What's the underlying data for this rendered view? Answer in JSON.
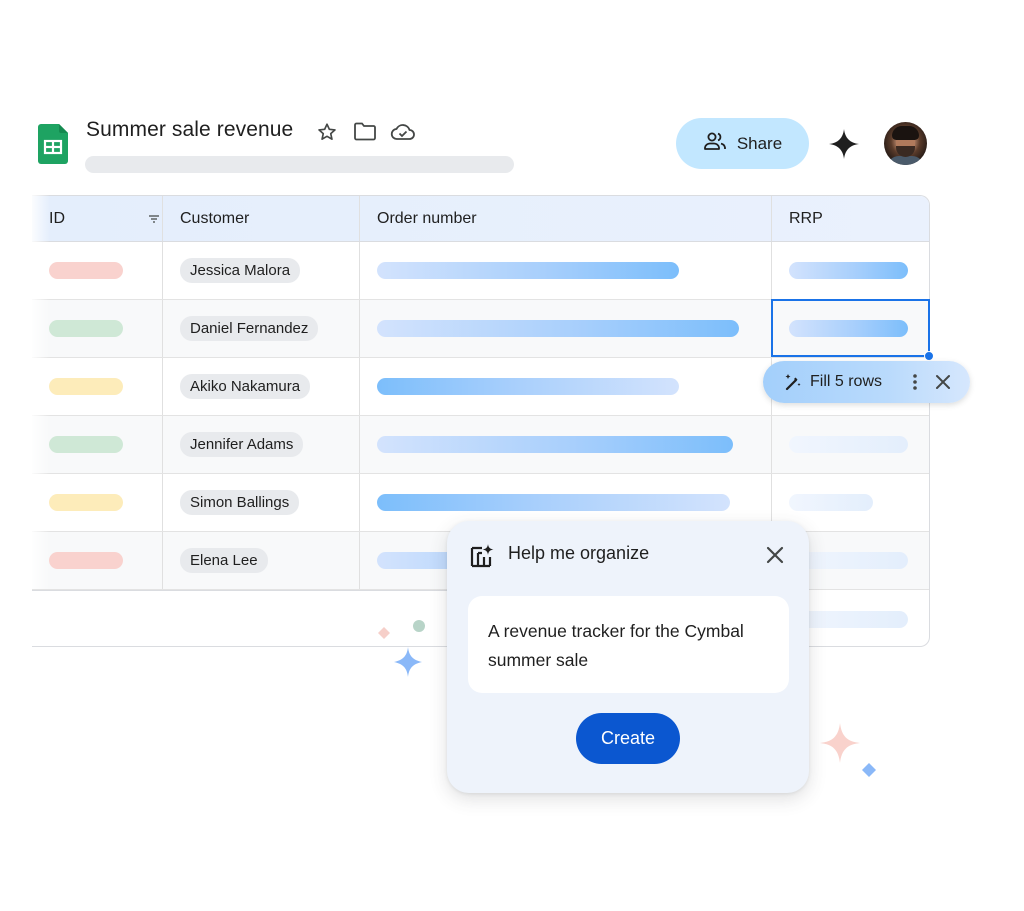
{
  "header": {
    "app_icon": "google-sheets-icon",
    "doc_title": "Summer sale revenue",
    "title_icons": [
      "star-icon",
      "folder-icon",
      "cloud-saved-icon"
    ],
    "share_label": "Share",
    "share_icon": "people-icon",
    "gemini_icon": "gemini-sparkle-icon",
    "avatar": "user-avatar"
  },
  "table": {
    "columns": [
      {
        "label": "ID",
        "icon": "filter-icon"
      },
      {
        "label": "Customer"
      },
      {
        "label": "Order number"
      },
      {
        "label": "RRP"
      }
    ],
    "rows": [
      {
        "id_color": "#f9d2ce",
        "customer": "Jessica Malora"
      },
      {
        "id_color": "#cfe8d6",
        "customer": "Daniel Fernandez"
      },
      {
        "id_color": "#fdecba",
        "customer": "Akiko Nakamura"
      },
      {
        "id_color": "#cfe8d6",
        "customer": "Jennifer Adams"
      },
      {
        "id_color": "#fdecba",
        "customer": "Simon Ballings"
      },
      {
        "id_color": "#f9d2ce",
        "customer": "Elena Lee"
      }
    ],
    "selected_cell": {
      "column": "RRP",
      "row": 2
    }
  },
  "fill_suggestion": {
    "icon": "magic-wand-icon",
    "label": "Fill 5 rows",
    "more_icon": "more-vert-icon",
    "close_icon": "close-icon"
  },
  "help_dialog": {
    "icon": "table-sparkle-icon",
    "title": "Help me organize",
    "close_icon": "close-icon",
    "prompt_text": "A revenue tracker for the Cymbal summer sale",
    "create_label": "Create"
  },
  "colors": {
    "accent": "#0b57d0",
    "share_bg": "#c2e7ff",
    "selection": "#1a73e8",
    "sheets_green": "#0f9d58",
    "dialog_bg": "#eef3fb"
  }
}
